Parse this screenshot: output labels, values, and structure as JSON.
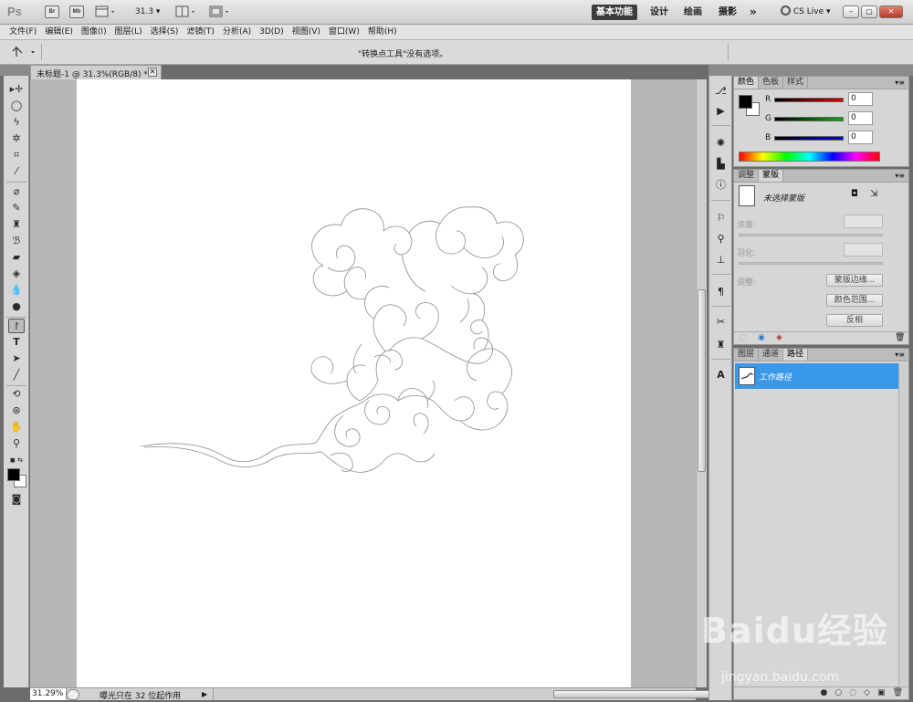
{
  "appbar": {
    "logo": "Ps",
    "bridge_label": "Br",
    "minibridge_label": "Mb",
    "zoom_value": "31.3",
    "workspaces": [
      "基本功能",
      "设计",
      "绘画",
      "摄影"
    ],
    "more": "»",
    "cs_live": "CS Live",
    "window_buttons": [
      "–",
      "▢",
      "✕"
    ]
  },
  "menu": [
    "文件(F)",
    "编辑(E)",
    "图像(I)",
    "图层(L)",
    "选择(S)",
    "滤镜(T)",
    "分析(A)",
    "3D(D)",
    "视图(V)",
    "窗口(W)",
    "帮助(H)"
  ],
  "options": {
    "message": "\"转换点工具\"没有选项。"
  },
  "document": {
    "tab_title": "未标题-1 @ 31.3%(RGB/8) *",
    "close": "✕"
  },
  "status": {
    "zoom": "31.29%",
    "message": "曝光只在 32 位起作用"
  },
  "color_panel": {
    "tabs": [
      "颜色",
      "色板",
      "样式"
    ],
    "channels": [
      {
        "name": "R",
        "value": "0",
        "color": "#e00000"
      },
      {
        "name": "G",
        "value": "0",
        "color": "#00b000"
      },
      {
        "name": "B",
        "value": "0",
        "color": "#0000e0"
      }
    ]
  },
  "mask_panel": {
    "tabs": [
      "调整",
      "蒙版"
    ],
    "no_mask": "未选择蒙版",
    "density_label": "浓度:",
    "feather_label": "羽化:",
    "refine_label": "调整:",
    "buttons": [
      "蒙版边缘...",
      "颜色范围...",
      "反相"
    ]
  },
  "layers_panel": {
    "tabs": [
      "图层",
      "通道",
      "路径"
    ],
    "path_name": "工作路径"
  },
  "watermark": {
    "brand": "Baidu经验",
    "url": "jingyan.baidu.com"
  },
  "colors": {
    "accent": "#3a98e8",
    "active_workspace": "#3d3d3d"
  }
}
